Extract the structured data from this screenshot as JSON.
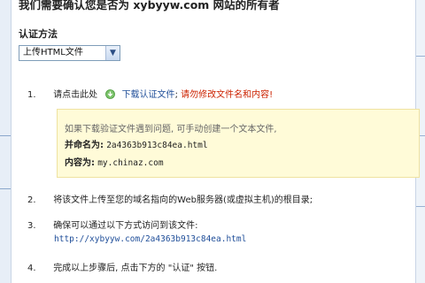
{
  "dialog": {
    "title": "我们需要确认您是否为 xybyyw.com 网站的所有者"
  },
  "method": {
    "label": "认证方法",
    "selected": "上传HTML文件"
  },
  "steps": [
    {
      "num": "1.",
      "prefix": "请点击此处",
      "download_link": "下载认证文件",
      "separator": ";",
      "warning": "请勿修改文件名和内容!"
    },
    {
      "num": "2.",
      "text": "将该文件上传至您的域名指向的Web服务器(或虚拟主机)的根目录;"
    },
    {
      "num": "3.",
      "text": "确保可以通过以下方式访问到该文件:",
      "url": "http://xybyyw.com/2a4363b913c84ea.html"
    },
    {
      "num": "4.",
      "text": "完成以上步骤后, 点击下方的 \"认证\" 按钮."
    }
  ],
  "hint": {
    "intro": "如果下载验证文件遇到问题, 可手动创建一个文本文件,",
    "name_label": "并命名为:",
    "name_value": "2a4363b913c84ea.html",
    "content_label": "内容为:",
    "content_value": "my.chinaz.com"
  },
  "colors": {
    "link": "#1f4e99",
    "warning": "#cc2200",
    "hint_background": "#fffbd8"
  }
}
